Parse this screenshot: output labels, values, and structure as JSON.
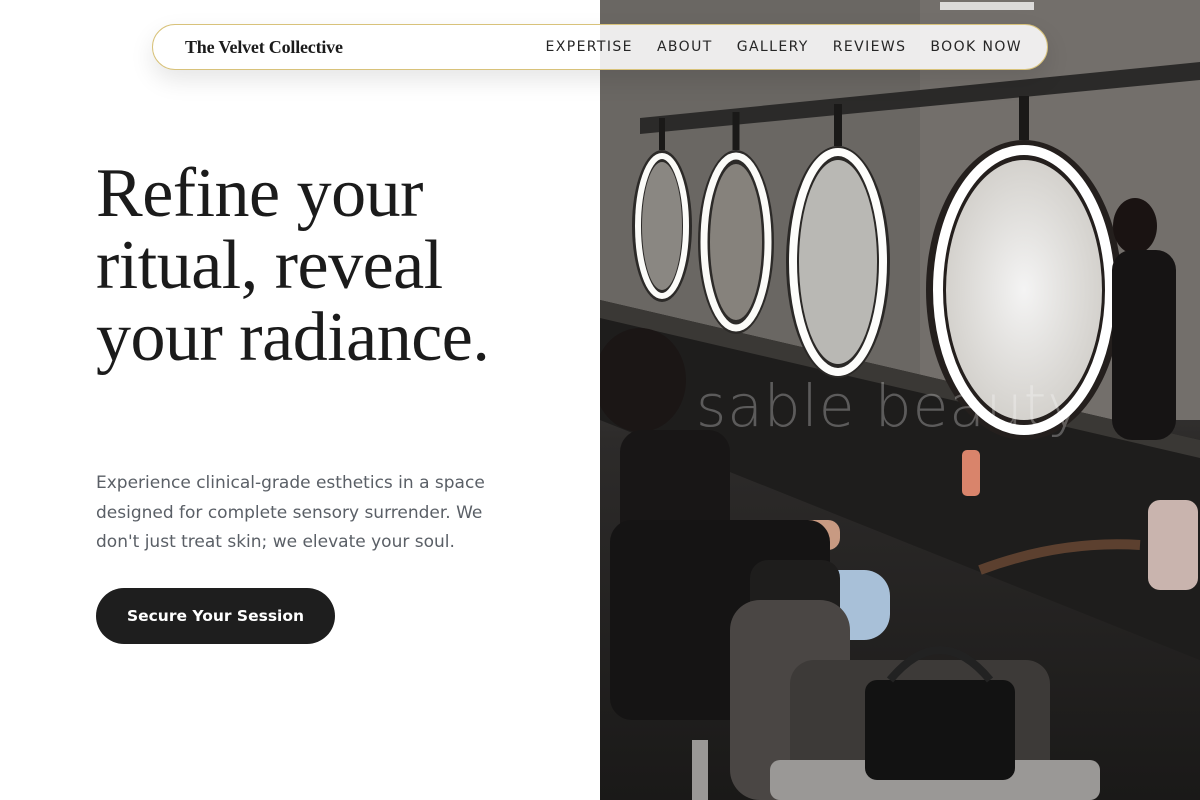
{
  "brand": {
    "name": "The Velvet Collective"
  },
  "nav": {
    "items": [
      {
        "label": "EXPERTISE"
      },
      {
        "label": "ABOUT"
      },
      {
        "label": "GALLERY"
      },
      {
        "label": "REVIEWS"
      },
      {
        "label": "BOOK NOW"
      }
    ]
  },
  "hero": {
    "title": "Refine your ritual, reveal your radiance.",
    "subtitle": "Experience clinical-grade esthetics in a space designed for complete sensory surrender. We don't just treat skin; we elevate your soul.",
    "cta_label": "Secure Your Session"
  },
  "photo": {
    "subject": "salon-interior-with-illuminated-round-mirrors",
    "watermark": "sable beauty"
  },
  "colors": {
    "text_dark": "#1b1b1b",
    "subtitle_gray": "#5a5f66",
    "button_bg": "#1e1e1e",
    "nav_border_gold": "#d8c27a"
  }
}
